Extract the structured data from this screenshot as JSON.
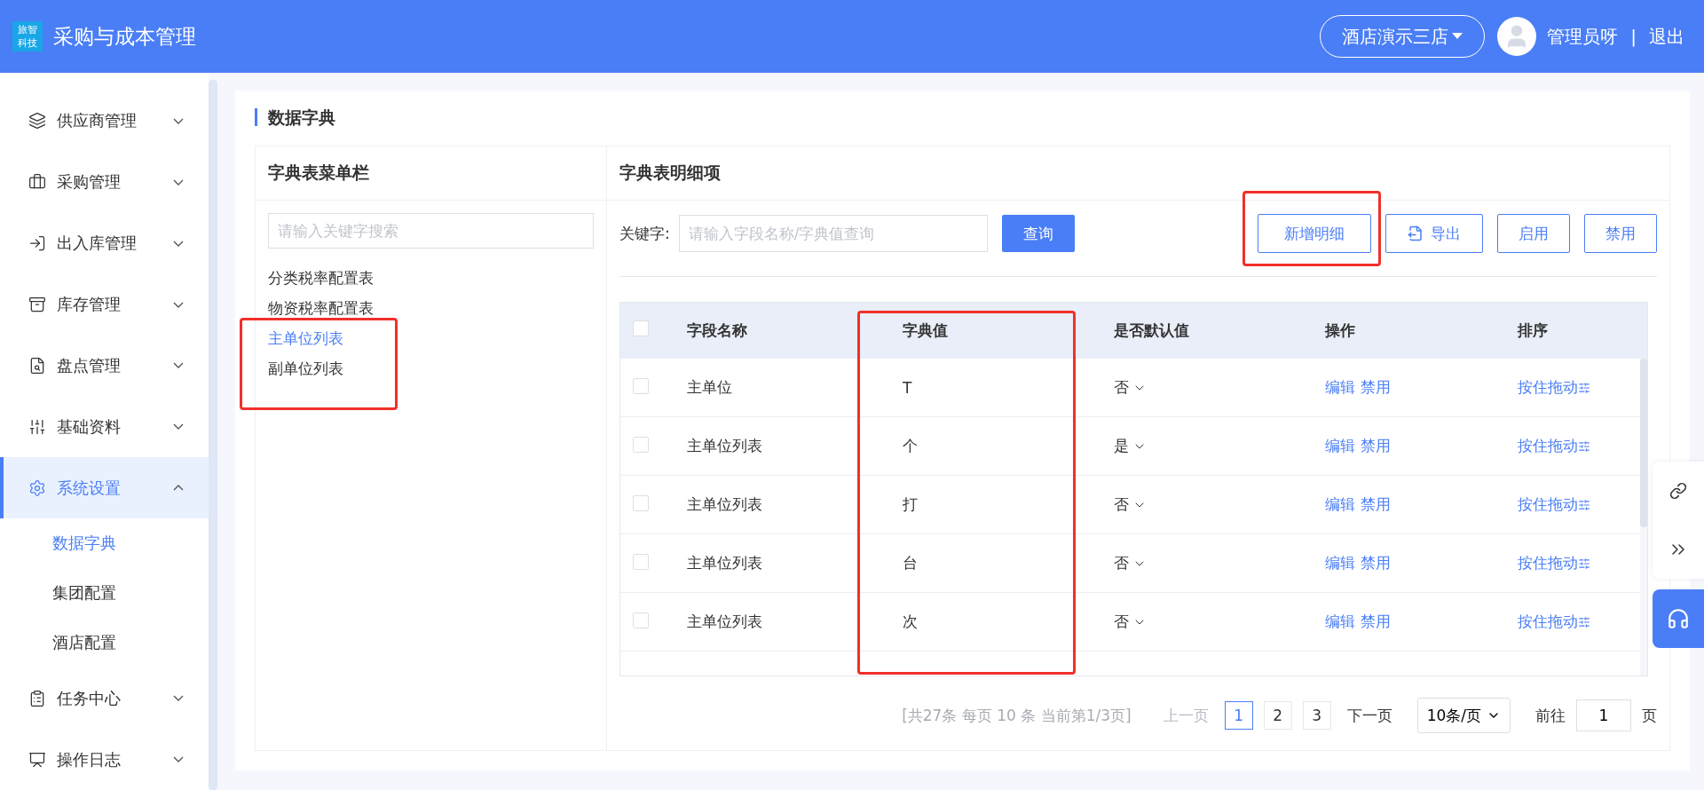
{
  "header": {
    "logo": "旅智科技",
    "title": "采购与成本管理",
    "store": "酒店演示三店",
    "user": "管理员呀",
    "separator": "|",
    "logout": "退出"
  },
  "sidebar": {
    "items": [
      {
        "label": "供应商管理",
        "expanded": false
      },
      {
        "label": "采购管理",
        "expanded": false
      },
      {
        "label": "出入库管理",
        "expanded": false
      },
      {
        "label": "库存管理",
        "expanded": false
      },
      {
        "label": "盘点管理",
        "expanded": false
      },
      {
        "label": "基础资料",
        "expanded": false
      },
      {
        "label": "系统设置",
        "expanded": true,
        "children": [
          {
            "label": "数据字典",
            "selected": true
          },
          {
            "label": "集团配置",
            "selected": false
          },
          {
            "label": "酒店配置",
            "selected": false
          }
        ]
      },
      {
        "label": "任务中心",
        "expanded": false
      },
      {
        "label": "操作日志",
        "expanded": false
      }
    ]
  },
  "page_title": "数据字典",
  "menu_panel": {
    "title": "字典表菜单栏",
    "search": {
      "placeholder": "请输入关键字搜索"
    },
    "items": [
      {
        "label": "分类税率配置表",
        "selected": false
      },
      {
        "label": "物资税率配置表",
        "selected": false
      },
      {
        "label": "主单位列表",
        "selected": true
      },
      {
        "label": "副单位列表",
        "selected": false
      }
    ]
  },
  "detail_panel": {
    "title": "字典表明细项",
    "keyword_label": "关键字:",
    "keyword": {
      "placeholder": "请输入字段名称/字典值查询"
    },
    "query_button": "查询",
    "buttons": [
      {
        "label": "新增明细",
        "kind": "plain"
      },
      {
        "label": "导出",
        "kind": "export"
      },
      {
        "label": "启用",
        "kind": "plain"
      },
      {
        "label": "禁用",
        "kind": "plain"
      }
    ],
    "table": {
      "select_all_checked": false,
      "columns": [
        "字段名称",
        "字典值",
        "是否默认值",
        "操作",
        "排序"
      ],
      "rows": [
        {
          "checked": false,
          "field": "主单位",
          "value": "T",
          "default": "否",
          "actions": [
            "编辑",
            "禁用"
          ],
          "sort": "按住拖动"
        },
        {
          "checked": false,
          "field": "主单位列表",
          "value": "个",
          "default": "是",
          "actions": [
            "编辑",
            "禁用"
          ],
          "sort": "按住拖动"
        },
        {
          "checked": false,
          "field": "主单位列表",
          "value": "打",
          "default": "否",
          "actions": [
            "编辑",
            "禁用"
          ],
          "sort": "按住拖动"
        },
        {
          "checked": false,
          "field": "主单位列表",
          "value": "台",
          "default": "否",
          "actions": [
            "编辑",
            "禁用"
          ],
          "sort": "按住拖动"
        },
        {
          "checked": false,
          "field": "主单位列表",
          "value": "次",
          "default": "否",
          "actions": [
            "编辑",
            "禁用"
          ],
          "sort": "按住拖动"
        }
      ]
    },
    "pagination": {
      "summary": "[共27条 每页 10 条 当前第1/3页]",
      "prev": "上一页",
      "prev_disabled": true,
      "pages": [
        {
          "label": "1",
          "selected": true
        },
        {
          "label": "2",
          "selected": false
        },
        {
          "label": "3",
          "selected": false
        }
      ],
      "next": "下一页",
      "page_size": "10条/页",
      "goto_label": "前往",
      "goto_value": "1",
      "goto_suffix": "页"
    }
  }
}
